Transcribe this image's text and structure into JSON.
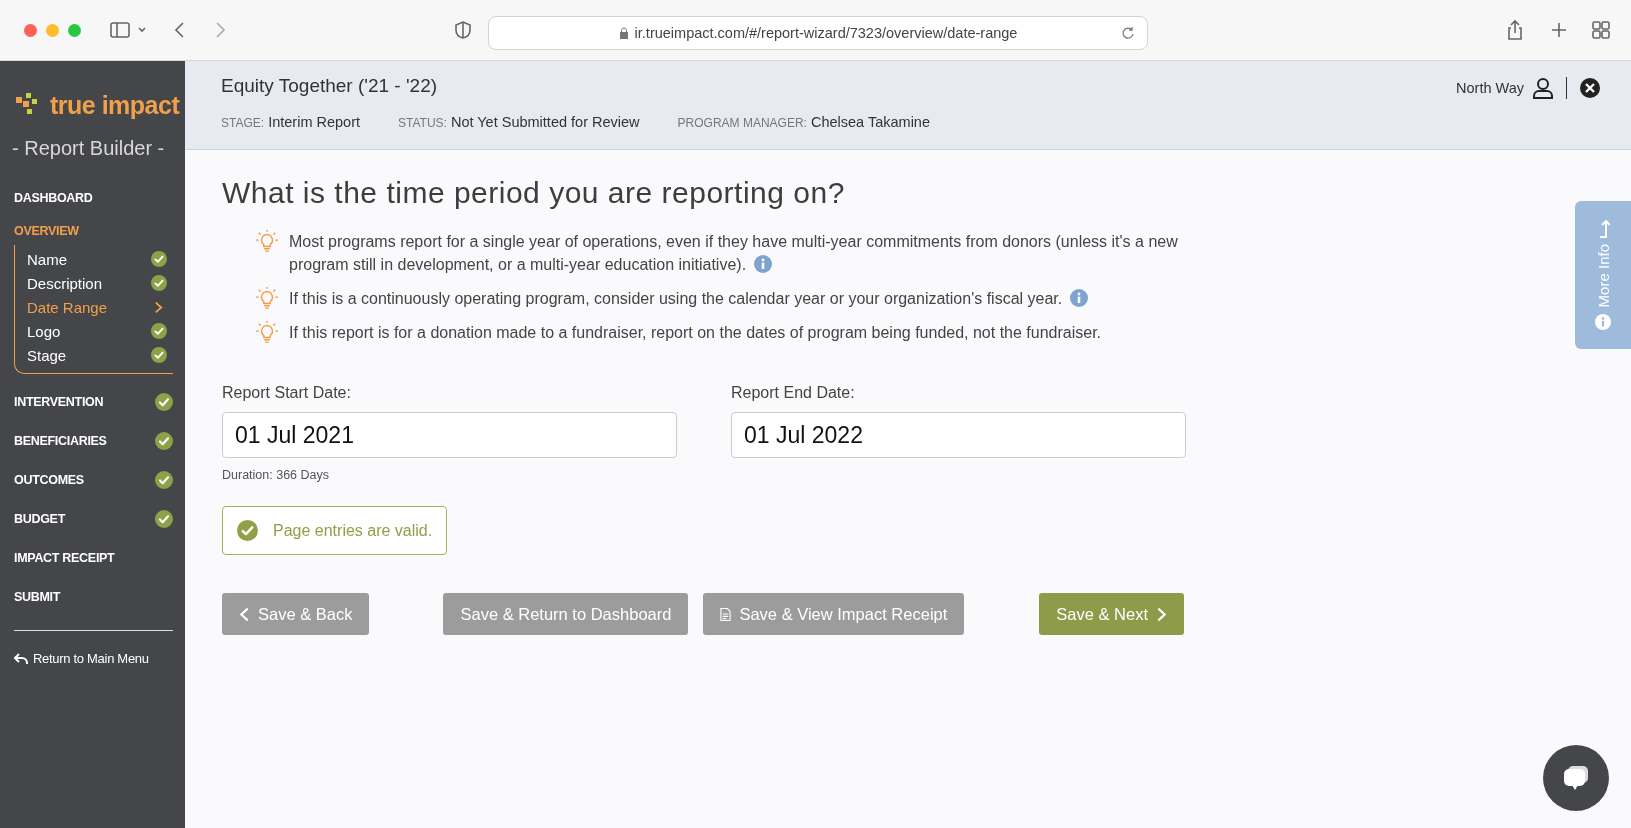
{
  "browser": {
    "url": "ir.trueimpact.com/#/report-wizard/7323/overview/date-range"
  },
  "sidebar": {
    "logo": "true impact",
    "subtitle": "- Report Builder -",
    "items": [
      {
        "label": "DASHBOARD",
        "selected": false,
        "complete": false
      },
      {
        "label": "OVERVIEW",
        "selected": true,
        "complete": false,
        "expanded": true,
        "children": [
          {
            "label": "Name",
            "selected": false,
            "complete": true
          },
          {
            "label": "Description",
            "selected": false,
            "complete": true
          },
          {
            "label": "Date Range",
            "selected": true,
            "complete": false
          },
          {
            "label": "Logo",
            "selected": false,
            "complete": true
          },
          {
            "label": "Stage",
            "selected": false,
            "complete": true
          }
        ]
      },
      {
        "label": "INTERVENTION",
        "selected": false,
        "complete": true
      },
      {
        "label": "BENEFICIARIES",
        "selected": false,
        "complete": true
      },
      {
        "label": "OUTCOMES",
        "selected": false,
        "complete": true
      },
      {
        "label": "BUDGET",
        "selected": false,
        "complete": true
      },
      {
        "label": "IMPACT RECEIPT",
        "selected": false,
        "complete": false
      },
      {
        "label": "SUBMIT",
        "selected": false,
        "complete": false
      }
    ],
    "return_link": "Return to Main Menu"
  },
  "header": {
    "title": "Equity Together ('21 - '22)",
    "meta": [
      {
        "label": "STAGE:",
        "value": "Interim Report"
      },
      {
        "label": "STATUS:",
        "value": "Not Yet Submitted for Review"
      },
      {
        "label": "PROGRAM MANAGER:",
        "value": "Chelsea Takamine"
      }
    ],
    "user": "North Way"
  },
  "page": {
    "question": "What is the time period you are reporting on?",
    "tips": [
      {
        "text": "Most programs report for a single year of operations, even if they have multi-year commitments from donors (unless it's a new program still in development, or a multi-year education initiative).",
        "info": true
      },
      {
        "text": "If this is a continuously operating program, consider using the calendar year or your organization's fiscal year.",
        "info": true
      },
      {
        "text": "If this report is for a donation made to a fundraiser, report on the dates of program being funded, not the fundraiser.",
        "info": false
      }
    ],
    "fields": [
      {
        "label": "Report Start Date:",
        "value": "01 Jul 2021"
      },
      {
        "label": "Report End Date:",
        "value": "01 Jul 2022"
      }
    ],
    "duration": "Duration: 366 Days",
    "validation": "Page entries are valid.",
    "buttons": [
      {
        "label": "Save & Back",
        "kind": "back"
      },
      {
        "label": "Save & Return to Dashboard",
        "kind": "plain"
      },
      {
        "label": "Save & View Impact Receipt",
        "kind": "document"
      },
      {
        "label": "Save & Next",
        "kind": "next"
      }
    ]
  },
  "more_info": "More Info"
}
